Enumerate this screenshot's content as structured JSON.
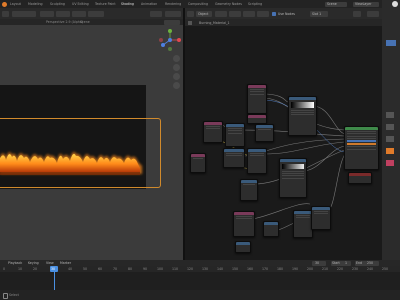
{
  "top_menu": [
    "Layout",
    "Modeling",
    "Sculpting",
    "UV Editing",
    "Texture Paint",
    "Shading",
    "Animation",
    "Rendering",
    "Compositing",
    "Geometry Nodes",
    "Scripting"
  ],
  "top_right": {
    "scene_label": "Scene",
    "layer_label": "ViewLayer"
  },
  "viewport": {
    "info_title": "Perspective 2.9 (Alpha)",
    "info_sub": "Scene"
  },
  "node_editor": {
    "object_label": "Object",
    "slot_label": "Slot 1",
    "material_name": "Burning_Material_1",
    "use_nodes_label": "Use Nodes"
  },
  "timeline": {
    "labels": [
      "Playback",
      "Keying",
      "View",
      "Marker"
    ],
    "start_label": "Start",
    "start_value": "1",
    "end_label": "End",
    "end_value": "250",
    "current_frame": "30",
    "ticks": [
      "0",
      "10",
      "20",
      "30",
      "40",
      "50",
      "60",
      "70",
      "80",
      "90",
      "100",
      "110",
      "120",
      "130",
      "140",
      "150",
      "160",
      "170",
      "180",
      "190",
      "200",
      "210",
      "220",
      "230",
      "240",
      "250"
    ]
  },
  "statusbar": {
    "text": "Select"
  },
  "colors": {
    "accent": "#4772b3",
    "fire": "#ff9a1a",
    "playhead": "#4a90e2",
    "frame_border": "#d08a2c"
  },
  "icons": [
    "hamburger-icon",
    "search-icon",
    "camera-icon",
    "grid-icon",
    "hand-icon",
    "zoom-icon",
    "gizmo-icon",
    "funnel-icon",
    "user-icon"
  ]
}
